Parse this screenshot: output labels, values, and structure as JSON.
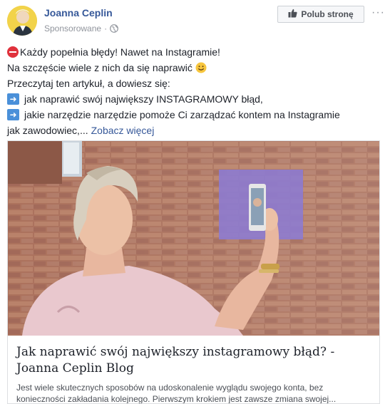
{
  "header": {
    "page_name": "Joanna Ceplin",
    "sponsored_label": "Sponsorowane",
    "separator": "·",
    "like_button_label": "Polub stronę",
    "more_label": "···"
  },
  "post": {
    "line1": "Każdy popełnia błędy! Nawet na Instagramie!",
    "line2": "Na szczęście wiele z nich da się naprawić",
    "line3": "Przeczytaj ten artykuł, a dowiesz się:",
    "line4": "jak naprawić swój największy INSTAGRAMOWY błąd,",
    "line5": "jakie narzędzie narzędzie pomoże Ci zarządzać kontem na Instagramie",
    "line6": "jak zawodowiec,...",
    "see_more": "Zobacz więcej"
  },
  "card": {
    "title_line1": "Jak naprawić swój największy instagramowy błąd? -",
    "title_line2": "Joanna Ceplin Blog",
    "desc_line1": "Jest wiele skutecznych sposobów na udoskonalenie wyglądu swojego konta, bez",
    "desc_line2": "konieczności zakładania kolejnego. Pierwszym krokiem jest zawsze zmiana swojej..."
  },
  "colors": {
    "link": "#365899",
    "text": "#1d2129",
    "meta": "#90949c"
  }
}
